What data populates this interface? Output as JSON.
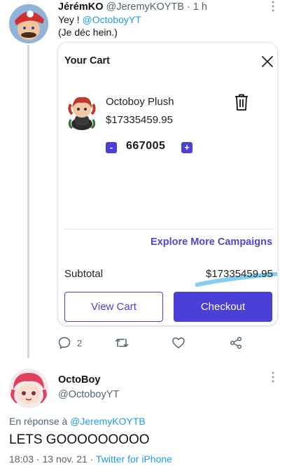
{
  "tweet1": {
    "name": "JérémKO",
    "handle": "@JeremyKOYTB",
    "time_sep": " · ",
    "time": "1 h",
    "line1_text": "Yey ! ",
    "line1_mention": "@OctoboyYT",
    "line2_text": "(Je déc hein.)"
  },
  "cart": {
    "title": "Your Cart",
    "product_name": "Octoboy Plush",
    "product_price": "$17335459.95",
    "quantity": "667005",
    "minus_label": "-",
    "plus_label": "+",
    "explore_label": "Explore More Campaigns",
    "subtotal_label": "Subtotal",
    "subtotal_value": "$17335459.95",
    "view_cart_label": "View Cart",
    "checkout_label": "Checkout",
    "accent_color": "#4a3fd6"
  },
  "actions": {
    "reply_count": "2"
  },
  "tweet2": {
    "name": "OctoBoy",
    "handle": "@OctoboyYT",
    "reply_prefix": "En réponse à ",
    "reply_mention": "@JeremyKOYTB",
    "text": "LETS GOOOOOOOOO",
    "datetime": "18:03 · 13 nov. 21 · ",
    "source": "Twitter for iPhone"
  },
  "icons": [
    "more-icon",
    "close-icon",
    "trash-icon",
    "reply-icon",
    "retweet-icon",
    "like-icon",
    "share-icon"
  ]
}
